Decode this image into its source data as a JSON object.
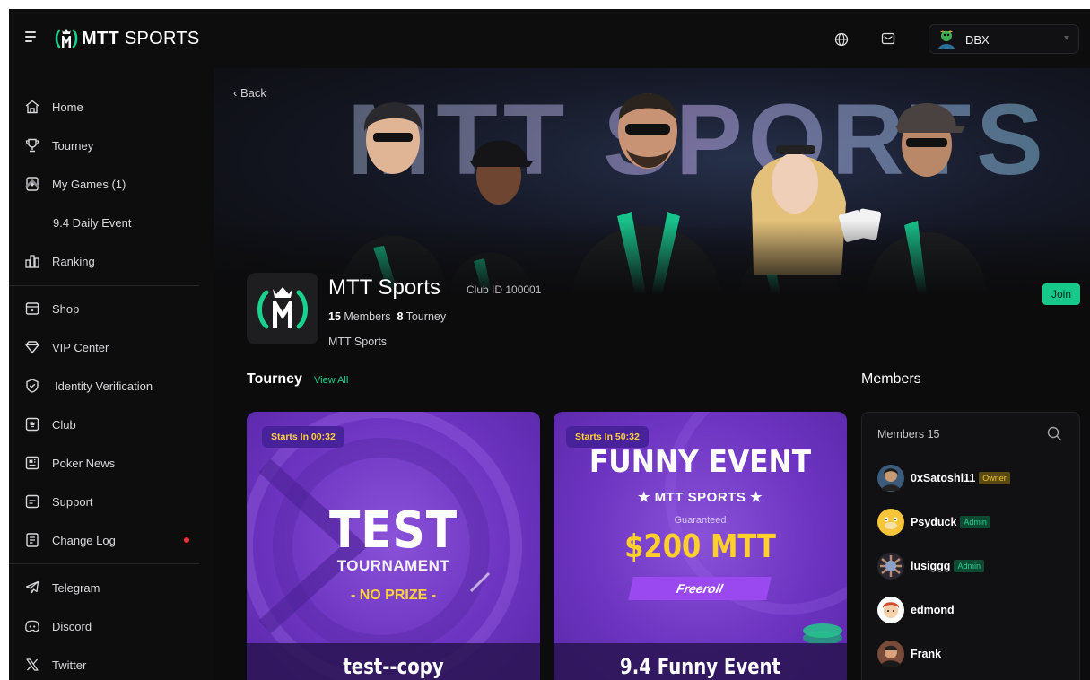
{
  "brand": {
    "bold": "MTT",
    "light": " SPORTS"
  },
  "user": {
    "name": "DBX"
  },
  "sidebar": {
    "items": [
      {
        "label": "Home",
        "icon": "home-icon"
      },
      {
        "label": "Tourney",
        "icon": "trophy-icon"
      },
      {
        "label": "My Games (1)",
        "icon": "cards-icon"
      },
      {
        "label": "9.4 Daily Event"
      },
      {
        "label": "Ranking",
        "icon": "ranking-icon"
      },
      {
        "label": "Shop",
        "icon": "shop-icon"
      },
      {
        "label": "VIP Center",
        "icon": "diamond-icon"
      },
      {
        "label": "Identity Verification",
        "icon": "shield-check-icon"
      },
      {
        "label": "Club",
        "icon": "club-icon"
      },
      {
        "label": "Poker News",
        "icon": "news-icon"
      },
      {
        "label": "Support",
        "icon": "support-icon"
      },
      {
        "label": "Change Log",
        "icon": "changelog-icon"
      },
      {
        "label": "Telegram",
        "icon": "telegram-icon"
      },
      {
        "label": "Discord",
        "icon": "discord-icon"
      },
      {
        "label": "Twitter",
        "icon": "x-twitter-icon"
      }
    ]
  },
  "main": {
    "back_label": "Back",
    "banner_text": "MTT SPORTS",
    "club": {
      "name": "MTT Sports",
      "id_label": "Club ID 100001",
      "members_count": "15",
      "members_label": "Members",
      "tourney_count": "8",
      "tourney_label": "Tourney",
      "description": "MTT Sports",
      "join_label": "Join"
    },
    "tourney_section": {
      "title": "Tourney",
      "view_all": "View All"
    },
    "cards": [
      {
        "starts": "Starts In 00:32",
        "art_main": "TEST",
        "art_sub": "TOURNAMENT",
        "art_note": "- NO PRIZE -",
        "title": "test--copy"
      },
      {
        "starts": "Starts In 50:32",
        "art_main": "FUNNY EVENT",
        "art_sub": "★ MTT SPORTS ★",
        "art_guaranteed": "Guaranteed",
        "art_prize": "$200 MTT",
        "art_freeroll": "Freeroll",
        "title": "9.4 Funny Event"
      }
    ],
    "members_section": {
      "title": "Members",
      "count_label": "Members 15",
      "list": [
        {
          "name": "0xSatoshi11",
          "role": "Owner"
        },
        {
          "name": "Psyduck",
          "role": "Admin"
        },
        {
          "name": "lusiggg",
          "role": "Admin"
        },
        {
          "name": "edmond",
          "role": ""
        },
        {
          "name": "Frank",
          "role": ""
        }
      ]
    }
  },
  "colors": {
    "accent_green": "#16c98a",
    "background": "#0c0c0d",
    "card_purple": "#6d34c1",
    "countdown_yellow": "#ffcf3a",
    "notification_red": "#ff2d3a"
  }
}
